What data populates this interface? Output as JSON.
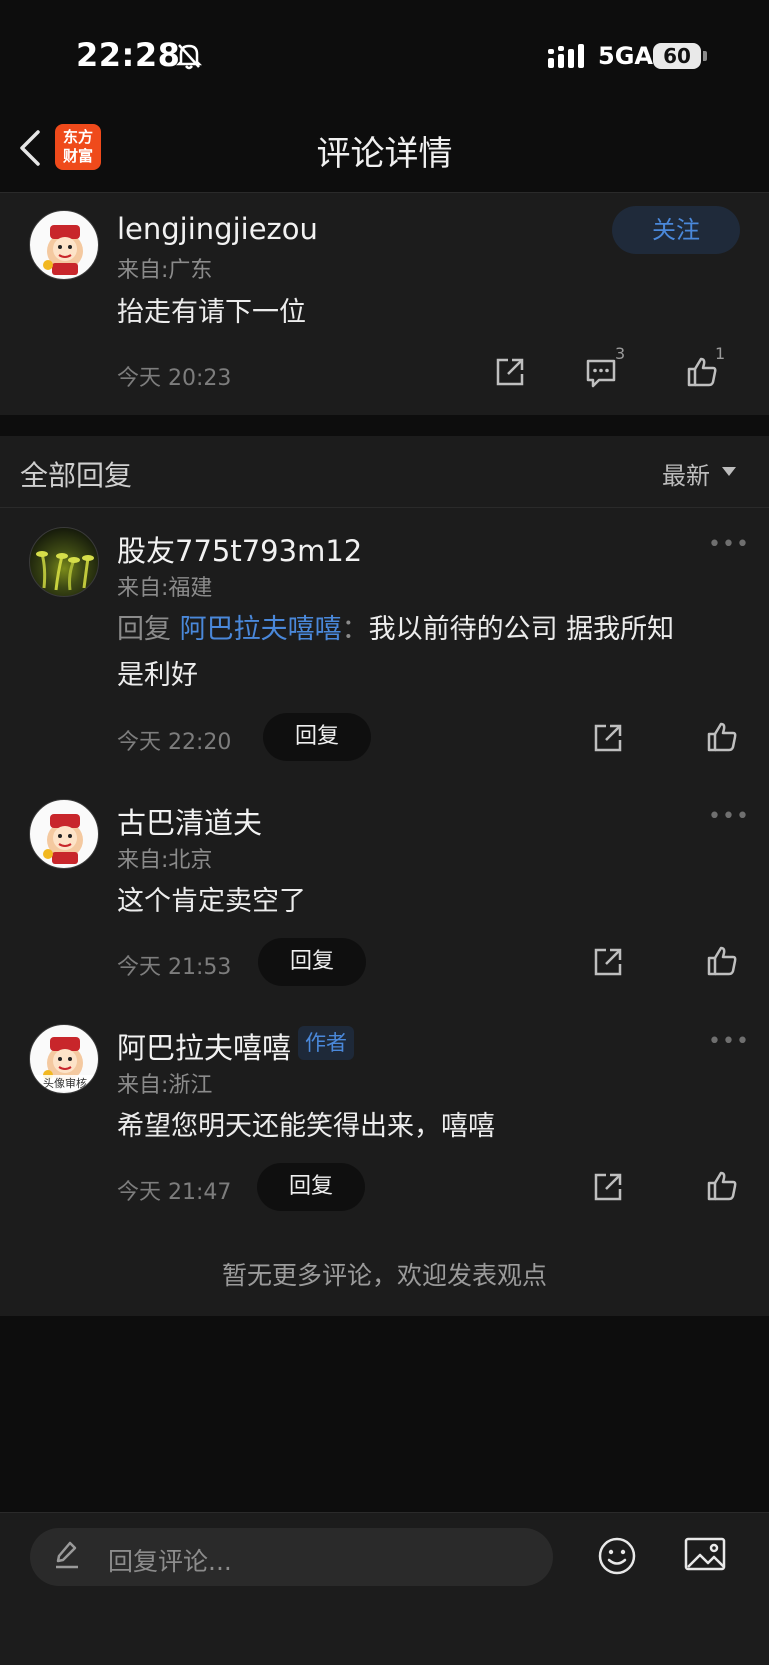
{
  "status_bar": {
    "time": "22:28",
    "network": "5GA",
    "battery": "60"
  },
  "nav": {
    "logo_line1": "东方",
    "logo_line2": "财富",
    "title": "评论详情"
  },
  "main_comment": {
    "username": "lengjingjiezou",
    "location": "来自:广东",
    "content": "抬走有请下一位",
    "time": "今天 20:23",
    "follow_label": "关注",
    "comment_count": "3",
    "like_count": "1"
  },
  "replies_header": {
    "title": "全部回复",
    "sort_label": "最新"
  },
  "replies": [
    {
      "username": "股友775t793m12",
      "location": "来自:福建",
      "reply_prefix": "回复",
      "reply_to": "阿巴拉夫嘻嘻",
      "reply_sep": "：",
      "content_line1": "我以前待的公司  据我所知",
      "content_line2": "是利好",
      "time": "今天 22:20",
      "reply_label": "回复",
      "more": "•••"
    },
    {
      "username": "古巴清道夫",
      "location": "来自:北京",
      "content": "这个肯定卖空了",
      "time": "今天 21:53",
      "reply_label": "回复",
      "more": "•••"
    },
    {
      "username": "阿巴拉夫嘻嘻",
      "badge": "作者",
      "location": "来自:浙江",
      "content": "希望您明天还能笑得出来，嘻嘻",
      "time": "今天 21:47",
      "reply_label": "回复",
      "more": "•••",
      "avatar_caption": "头像审核"
    }
  ],
  "footer_note": "暂无更多评论，欢迎发表观点",
  "bottom_bar": {
    "input_placeholder": "回复评论..."
  },
  "colors": {
    "accent": "#4a88da",
    "brand": "#ef4a1b",
    "background": "#0d0d0d",
    "card": "#1c1c1c"
  },
  "icons": [
    "bell-off-icon",
    "signal-icon",
    "back-icon",
    "share-icon",
    "comment-icon",
    "like-icon",
    "sort-arrow-icon",
    "more-icon",
    "pencil-icon",
    "emoji-icon",
    "image-icon"
  ]
}
